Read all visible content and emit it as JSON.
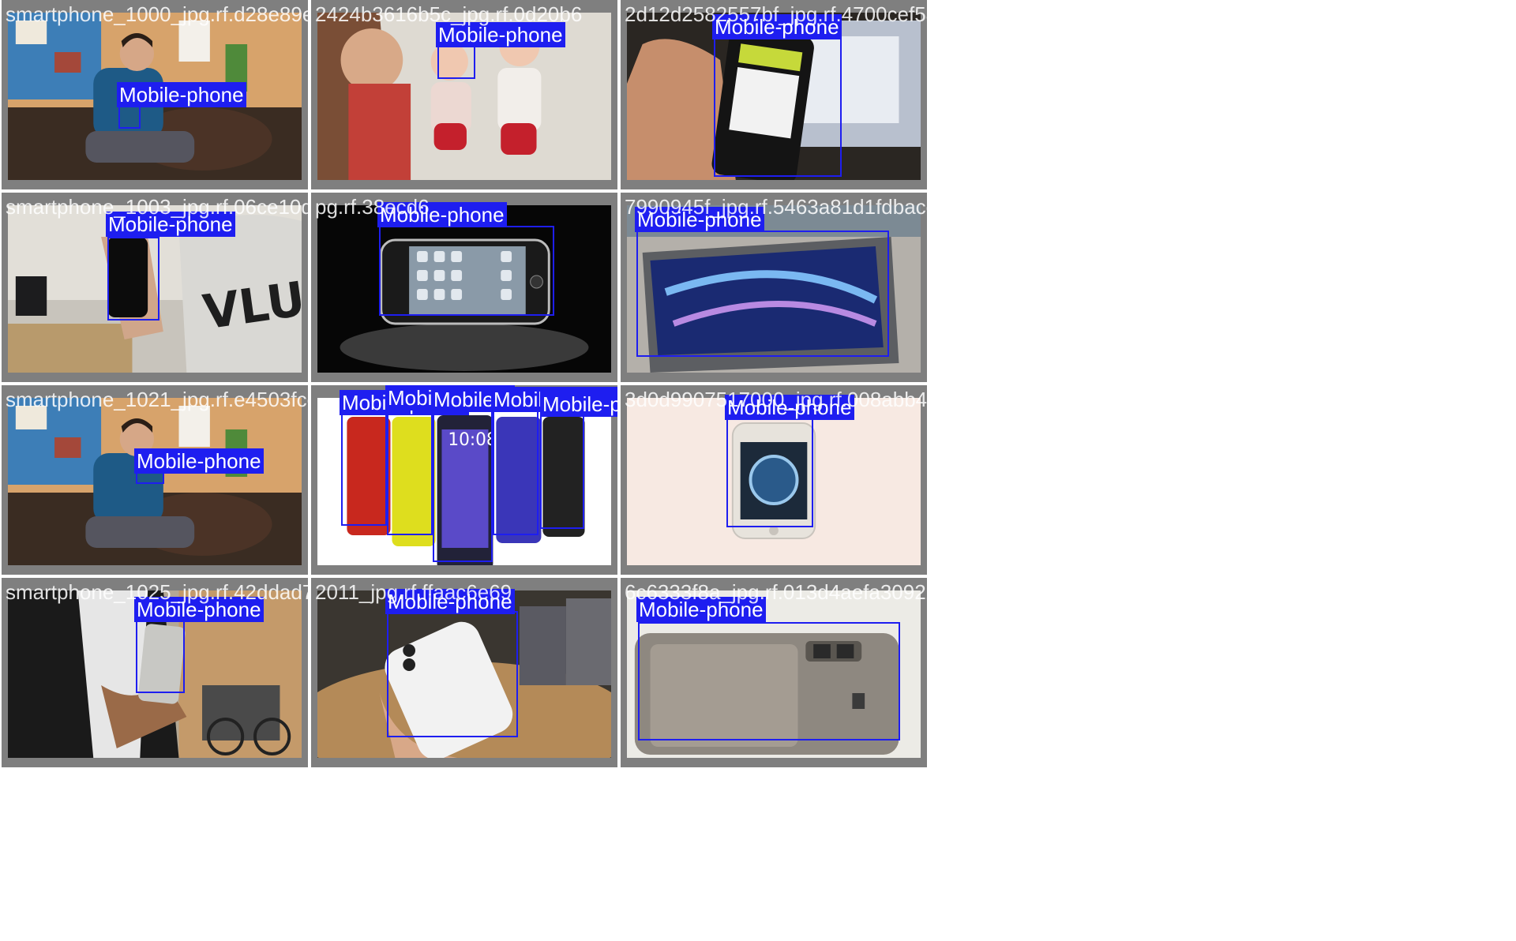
{
  "grid": {
    "columns": 3,
    "rows": 4
  },
  "colors": {
    "box": "#1e1ef0",
    "label_text": "#ffffff",
    "frame": "#7f7f7f"
  },
  "cells": [
    {
      "file": "smartphone_1000_jpg.rf.d28e89e94e4a2d0b",
      "scene": "man-on-sofa",
      "boxes": [
        {
          "label": "Mobile-phone"
        }
      ]
    },
    {
      "file": "2424b3616b5c_jpg.rf.0d20b6",
      "scene": "babies-photo",
      "boxes": [
        {
          "label": "Mobile-phone"
        }
      ]
    },
    {
      "file": "2d12d2582557bf_jpg.rf.4700cef58fac5e65",
      "scene": "nokia-hand",
      "boxes": [
        {
          "label": "Mobile-phone"
        }
      ]
    },
    {
      "file": "smartphone_1003_jpg.rf.06ce10d3",
      "scene": "black-phone-hand",
      "boxes": [
        {
          "label": "Mobile-phone"
        }
      ]
    },
    {
      "file": "pg.rf.38ecd6",
      "scene": "iphone-black",
      "boxes": [
        {
          "label": "Mobile-phone"
        }
      ]
    },
    {
      "file": "7990945f_jpg.rf.5463a81d1fdbace5",
      "scene": "htc-table",
      "boxes": [
        {
          "label": "Mobile-phone"
        }
      ]
    },
    {
      "file": "smartphone_1021_jpg.rf.e4503fce",
      "scene": "man-on-sofa",
      "boxes": [
        {
          "label": "Mobile-phone"
        }
      ]
    },
    {
      "file": "",
      "scene": "htc-lineup",
      "boxes": [
        {
          "label": "Mobile-phone"
        },
        {
          "label": "Mobile-phone"
        },
        {
          "label": "Mobile-phone"
        },
        {
          "label": "Mobile-phone"
        },
        {
          "label": "Mobile-phone"
        }
      ]
    },
    {
      "file": "3d0d9907517000_jpg.rf.008abb4cb4326811",
      "scene": "iphone-white",
      "boxes": [
        {
          "label": "Mobile-phone"
        }
      ]
    },
    {
      "file": "smartphone_1025_jpg.rf.42ddad725",
      "scene": "man-jacket",
      "boxes": [
        {
          "label": "Mobile-phone"
        }
      ]
    },
    {
      "file": "2011_jpg.rf.ffaac6e69",
      "scene": "iphonex-hand",
      "boxes": [
        {
          "label": "Mobile-phone"
        }
      ]
    },
    {
      "file": "6c6333f8a_jpg.rf.013d4aefa3092218",
      "scene": "nokia-back",
      "boxes": [
        {
          "label": "Mobile-phone"
        }
      ]
    }
  ]
}
